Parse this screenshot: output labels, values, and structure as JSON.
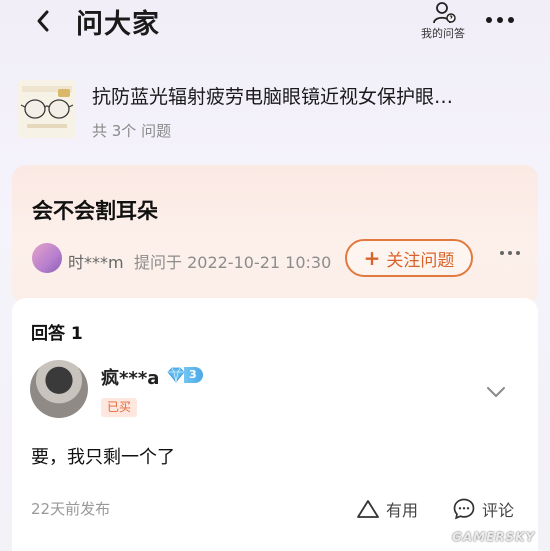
{
  "header": {
    "title": "问大家",
    "my_questions_label": "我的问答"
  },
  "product": {
    "name": "抗防蓝光辐射疲劳电脑眼镜近视女保护眼…",
    "question_count": "共 3个 问题"
  },
  "question": {
    "title": "会不会割耳朵",
    "asker": "时***m",
    "asked_at": "提问于 2022-10-21 10:30",
    "follow_label": "关注问题"
  },
  "answers": {
    "heading": "回答 1",
    "items": [
      {
        "user": "疯***a",
        "level": "3",
        "tag": "已买",
        "text": "要，我只剩一个了",
        "time": "22天前发布",
        "useful_label": "有用",
        "comment_label": "评论"
      }
    ]
  },
  "watermark": "GAMERSKY",
  "colors": {
    "accent": "#e2793f",
    "question_card_bg": "#fbe9e4",
    "badge_blue": "#4aa8e8",
    "bought_tag": "#e26a3c"
  },
  "icons": [
    "chevron-left-icon",
    "user-question-icon",
    "more-dots-icon",
    "plus-icon",
    "chevron-down-icon",
    "diamond-icon",
    "thumb-up-triangle-icon",
    "comment-bubble-icon"
  ]
}
